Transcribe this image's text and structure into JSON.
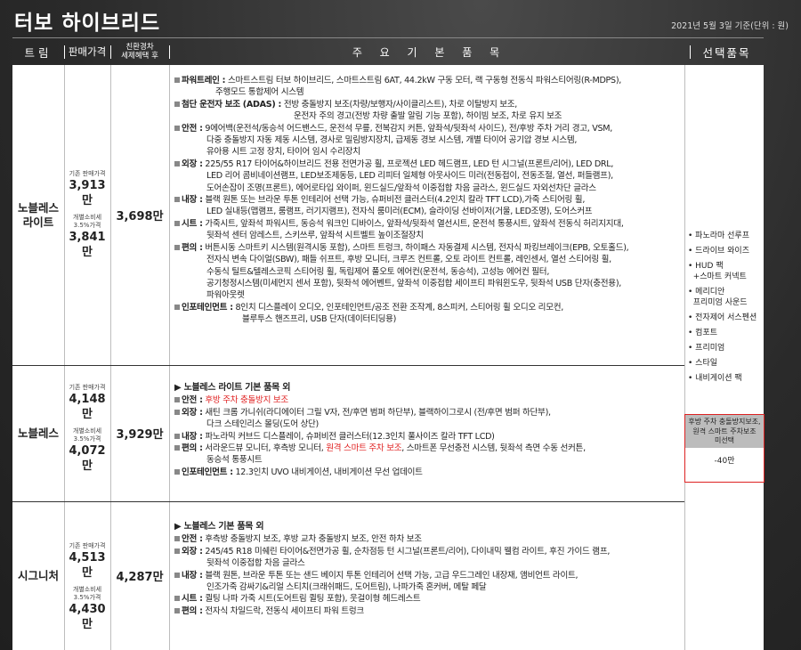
{
  "title": "터보 하이브리드",
  "date": "2021년 5월 3일 기준(단위 : 원)",
  "header": {
    "trim": "트림",
    "price": "판매가격",
    "sub_a": "친환경차",
    "sub_b": "세제혜택 후",
    "features": "주 요 기 본 품 목",
    "options": "선택품목"
  },
  "price_labels": {
    "base": "기존 판매가격",
    "ind_a": "개별소비세",
    "ind_b": "3.5%가격"
  },
  "trims": [
    {
      "name_a": "노블레스",
      "name_b": "라이트",
      "base_price": "3,913만",
      "tax_price": "3,841만",
      "final": "3,698만",
      "features": [
        {
          "label": "파워트레인 :",
          "lines": [
            "스마트스트림 터보 하이브리드, 스마트스트림 6AT, 44.2kW 구동 모터, 랙 구동형 전동식 파워스티어링(R-MDPS),",
            "주행모드 통합제어 시스템"
          ]
        },
        {
          "label": "첨단 운전자 보조 (ADAS) :",
          "lines": [
            "전방 충돌방지 보조(차량/보행자/사이클리스트), 차로 이탈방지 보조,",
            "운전자 주의 경고(전방 차량 출발 알림 기능 포함), 하이빔 보조, 차로 유지 보조"
          ]
        },
        {
          "label": "안전 :",
          "lines": [
            "9에어백(운전석/동승석 어드밴스드, 운전석 무릎, 전복감지 커튼, 앞좌석/뒷좌석 사이드), 전/후방 주차 거리 경고, VSM,",
            "다중 충돌방지 자동 제동 시스템, 경사로 밀림방지장치, 급제동 경보 시스템, 개별 타이어 공기압 경보 시스템,",
            "유아용 시트 고정 장치, 타이어 임시 수리장치"
          ]
        },
        {
          "label": "외장 :",
          "lines": [
            "225/55 R17 타이어&하이브리드 전용 전면가공 휠, 프로젝션 LED 헤드램프, LED 턴 시그널(프론트/리어), LED DRL,",
            "LED 리어 콤비네이션램프, LED보조제동등, LED 리피터 일체형 아웃사이드 미러(전동접이, 전동조절, 열선, 퍼들램프),",
            "도어손잡이 조명(프론트), 에어로타입 와이퍼, 윈드실드/앞좌석 이중접합 차음 글라스, 윈드실드 자외선차단 글라스"
          ]
        },
        {
          "label": "내장 :",
          "lines": [
            "블랙 원톤 또는 브라운 투톤 인테리어 선택 가능, 슈퍼비전 클러스터(4.2인치 칼라 TFT LCD),가죽 스티어링 휠,",
            "LED 실내등(맵램프, 룸램프, 러기지램프), 전자식 룸미러(ECM), 슬라이딩 선바이저(거울, LED조명), 도어스커프"
          ]
        },
        {
          "label": "시트 :",
          "lines": [
            "가죽시트, 앞좌석 파워시트, 동승석 워크인 디바이스, 앞좌석/뒷좌석 열선시트, 운전석 통풍시트, 앞좌석 전동식 허리지지대,",
            "뒷좌석 센터 암레스트, 스키쓰루, 앞좌석 시트벨트 높이조절장치"
          ]
        },
        {
          "label": "편의 :",
          "lines": [
            "버튼시동 스마트키 시스템(원격시동 포함), 스마트 트렁크, 하이패스 자동결제 시스템, 전자식 파킹브레이크(EPB, 오토홀드),",
            "전자식 변속 다이얼(SBW), 패들 쉬프트, 후방 모니터, 크루즈 컨트롤, 오토 라이트 컨트롤, 레인센서, 열선 스티어링 휠,",
            "수동식 틸트&텔레스코픽 스티어링 휠, 독립제어 풀오토 에어컨(운전석, 동승석), 고성능 에어컨 필터,",
            "공기청정시스템(미세먼지 센서 포함), 뒷좌석 에어벤트, 앞좌석 이중접합 세이프티 파워윈도우, 뒷좌석 USB 단자(충전용),",
            "파워아웃렛"
          ]
        },
        {
          "label": "인포테인먼트 :",
          "lines": [
            "8인치 디스플레이 오디오, 인포테인먼트/공조 전환 조작계, 8스피커, 스티어링 휠 오디오 리모컨,",
            "블루투스 핸즈프리, USB 단자(데이터티딩용)"
          ]
        }
      ]
    },
    {
      "name_a": "노블레스",
      "name_b": "",
      "base_price": "4,148만",
      "tax_price": "4,072만",
      "final": "3,929만",
      "heading": "▶ 노블레스 라이트 기본 품목 외",
      "features": [
        {
          "label": "안전 :",
          "lines": [
            "후방 주차 충돌방지 보조"
          ],
          "red": true
        },
        {
          "label": "외장 :",
          "lines": [
            "새틴 크롬 가니쉬(라디에이터 그릴 V자, 전/후면 범퍼 하단부), 블랙하이그로시 (전/후면 범퍼 하단부),",
            "다크 스테인리스 몰딩(도어 상단)"
          ]
        },
        {
          "label": "내장 :",
          "lines": [
            "파노라믹 커브드 디스플레이, 슈퍼비전 클러스터(12.3인치 풀사이즈 칼라 TFT LCD)"
          ]
        },
        {
          "label": "편의 :",
          "lines": [
            "서라운드뷰 모니터, 후측방 모니터, ",
            "동승석 통풍시트"
          ],
          "red_mid": "원격 스마트 주차 보조",
          "tail": ", 스마트폰 무선충전 시스템, 뒷좌석 측면 수동 선커튼,"
        },
        {
          "label": "인포테인먼트 :",
          "lines": [
            "12.3인치 UVO 내비게이션, 내비게이션 무선 업데이트"
          ]
        }
      ]
    },
    {
      "name_a": "시그니처",
      "name_b": "",
      "base_price": "4,513만",
      "tax_price": "4,430만",
      "final": "4,287만",
      "heading": "▶ 노블레스 기본 품목 외",
      "features": [
        {
          "label": "안전 :",
          "lines": [
            "후측방 충돌방지 보조, 후방 교차 충돌방지 보조, 안전 하차 보조"
          ]
        },
        {
          "label": "외장 :",
          "lines": [
            "245/45 R18 미쉐린 타이어&전면가공 휠, 순차점등 턴 시그널(프론트/리어), 다이내믹 웰컴 라이트, 후진 가이드 램프,",
            "뒷좌석 이중접합 차음 글라스"
          ]
        },
        {
          "label": "내장 :",
          "lines": [
            "블랙 원톤, 브라운 투톤 또는 샌드 베이지 투톤 인테리어 선택 가능, 고급 우드그레인 내장재, 앰비언트 라이트,",
            "인조가죽 감싸기&리얼 스티치(크래쉬패드, 도어트림), 나파가죽 혼커버, 메탈 페달"
          ]
        },
        {
          "label": "시트 :",
          "lines": [
            "퀼팅 나파 가죽 시트(도어트림 퀼팅 포함), 웃걸이형 헤드레스트"
          ]
        },
        {
          "label": "편의 :",
          "lines": [
            "전자식 차일드락, 전동식 세이프티 파워 트렁크"
          ]
        }
      ]
    }
  ],
  "options": [
    "• 파노라마 선루프",
    "• 드라이브 와이즈",
    "• HUD 팩",
    "  +스마트 커넥트",
    "• 메리디안",
    "  프리미엄 사운드",
    "• 전자제어 서스펜션",
    "• 컴포트",
    "• 프리미엄",
    "• 스타일",
    "• 내비게이션 팩"
  ],
  "package": {
    "line1": "후방 주차 충돌방지보조,",
    "line2": "원격 스마트 주차보조",
    "line3": "미선택",
    "value": "-40만"
  },
  "colors": {
    "accent_red": "#e02020",
    "header_bg": "#2c2c2c"
  }
}
